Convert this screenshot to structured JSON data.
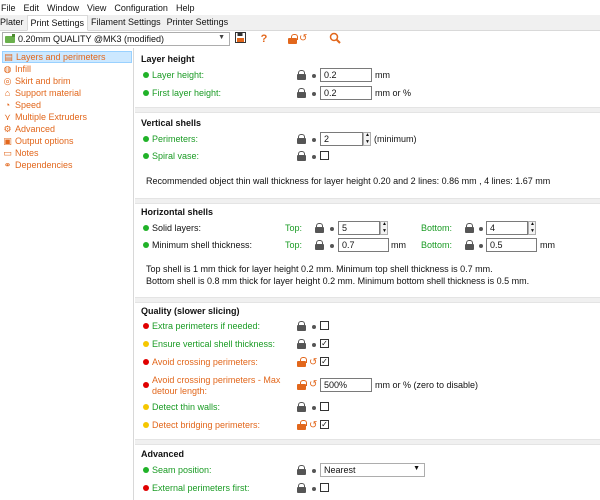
{
  "menu": [
    "File",
    "Edit",
    "Window",
    "View",
    "Configuration",
    "Help"
  ],
  "tabs": [
    "Plater",
    "Print Settings",
    "Filament Settings",
    "Printer Settings"
  ],
  "preset": {
    "name": "0.20mm QUALITY @MK3 (modified)"
  },
  "toolbar_icons": [
    "save-icon",
    "help-icon",
    "lock-undo-icon",
    "search-icon"
  ],
  "sidebar": [
    {
      "label": "Layers and perimeters",
      "icon": "layers-icon"
    },
    {
      "label": "Infill",
      "icon": "infill-icon"
    },
    {
      "label": "Skirt and brim",
      "icon": "skirt-icon"
    },
    {
      "label": "Support material",
      "icon": "support-icon"
    },
    {
      "label": "Speed",
      "icon": "speed-icon"
    },
    {
      "label": "Multiple Extruders",
      "icon": "extruders-icon"
    },
    {
      "label": "Advanced",
      "icon": "advanced-icon"
    },
    {
      "label": "Output options",
      "icon": "output-icon"
    },
    {
      "label": "Notes",
      "icon": "notes-icon"
    },
    {
      "label": "Dependencies",
      "icon": "dependencies-icon"
    }
  ],
  "layer_height": {
    "title": "Layer height",
    "layer_height_label": "Layer height:",
    "layer_height_value": "0.2",
    "layer_height_unit": "mm",
    "first_layer_label": "First layer height:",
    "first_layer_value": "0.2",
    "first_layer_unit": "mm or %"
  },
  "vertical_shells": {
    "title": "Vertical shells",
    "perimeters_label": "Perimeters:",
    "perimeters_value": "2",
    "perimeters_unit": "(minimum)",
    "spiral_label": "Spiral vase:",
    "info": "Recommended object thin wall thickness for layer height 0.20 and 2 lines: 0.86 mm , 4 lines: 1.67 mm"
  },
  "horizontal_shells": {
    "title": "Horizontal shells",
    "solid_label": "Solid layers:",
    "top_label": "Top:",
    "bottom_label": "Bottom:",
    "solid_top": "5",
    "solid_bottom": "4",
    "min_label": "Minimum shell thickness:",
    "min_top": "0.7",
    "min_bottom": "0.5",
    "unit": "mm",
    "info1": "Top shell is 1 mm thick for layer height 0.2 mm. Minimum top shell thickness is 0.7 mm.",
    "info2": "Bottom shell is 0.8 mm thick for layer height 0.2 mm. Minimum bottom shell thickness is 0.5 mm."
  },
  "quality": {
    "title": "Quality (slower slicing)",
    "extra_label": "Extra perimeters if needed:",
    "ensure_label": "Ensure vertical shell thickness:",
    "avoid_label": "Avoid crossing perimeters:",
    "detour_label_1": "Avoid crossing perimeters - Max",
    "detour_label_2": "detour length:",
    "detour_value": "500%",
    "detour_unit": "mm or % (zero to disable)",
    "thin_label": "Detect thin walls:",
    "bridging_label": "Detect bridging perimeters:"
  },
  "advanced": {
    "title": "Advanced",
    "seam_label": "Seam position:",
    "seam_value": "Nearest",
    "external_label": "External perimeters first:"
  },
  "colors": {
    "accent": "#e2671c",
    "green": "#1a9b24",
    "selected": "#cce8ff"
  }
}
